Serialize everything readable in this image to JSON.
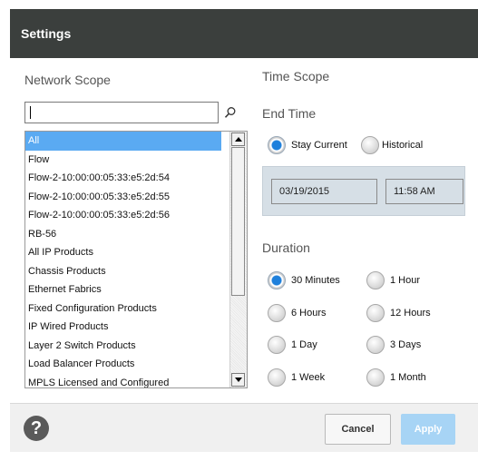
{
  "dialog": {
    "title": "Settings"
  },
  "network_scope": {
    "label": "Network Scope",
    "search": {
      "value": "",
      "placeholder": ""
    },
    "items": [
      "All",
      "Flow",
      "Flow-2-10:00:00:05:33:e5:2d:54",
      "Flow-2-10:00:00:05:33:e5:2d:55",
      "Flow-2-10:00:00:05:33:e5:2d:56",
      "RB-56",
      "All IP Products",
      "Chassis Products",
      "Ethernet Fabrics",
      "Fixed Configuration Products",
      "IP Wired Products",
      "Layer 2 Switch Products",
      "Load Balancer Products",
      "MPLS Licensed and Configured"
    ],
    "selected_item": "All"
  },
  "time_scope": {
    "label": "Time Scope",
    "end_time": {
      "label": "End Time",
      "options": [
        "Stay Current",
        "Historical"
      ],
      "selected": "Stay Current",
      "date": "03/19/2015",
      "time": "11:58 AM"
    },
    "duration": {
      "label": "Duration",
      "options": [
        "30 Minutes",
        "1 Hour",
        "6 Hours",
        "12 Hours",
        "1 Day",
        "3 Days",
        "1 Week",
        "1 Month"
      ],
      "selected": "30 Minutes"
    }
  },
  "footer": {
    "help_glyph": "?",
    "cancel_label": "Cancel",
    "apply_label": "Apply"
  },
  "colors": {
    "titlebar": "#3b3f3d",
    "selection": "#5aaaf2",
    "radio_checked": "#1e80dc",
    "apply_button": "#a7d4f5"
  },
  "icons": [
    "search-icon",
    "help-icon"
  ]
}
